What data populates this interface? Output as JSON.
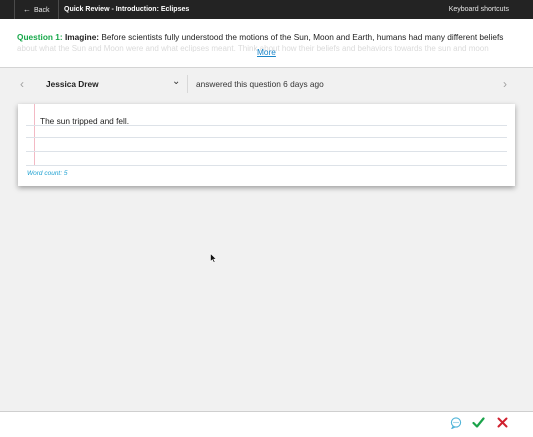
{
  "topbar": {
    "back_label": "Back",
    "title": "Quick Review - Introduction: Eclipses",
    "shortcuts_label": "Keyboard shortcuts"
  },
  "question": {
    "label": "Question 1:",
    "imagine": "Imagine:",
    "text": "Before scientists fully understood the motions of the Sun, Moon and Earth, humans had many different beliefs",
    "faded_text": "about what the Sun and Moon were and what eclipses meant. Think about how their beliefs and behaviors towards the sun and moon",
    "more_label": "More"
  },
  "response_nav": {
    "student_name": "Jessica Drew",
    "answered_text": "answered this question 6 days ago"
  },
  "response": {
    "text": "The sun tripped and fell.",
    "word_count": "Word count: 5"
  },
  "bottom_actions": {
    "comment_icon": "comment-icon",
    "check_icon": "check-icon",
    "cross_icon": "close-icon",
    "check_color": "#1aa34a",
    "cross_color": "#d0202e",
    "comment_color": "#4fb4d8"
  }
}
